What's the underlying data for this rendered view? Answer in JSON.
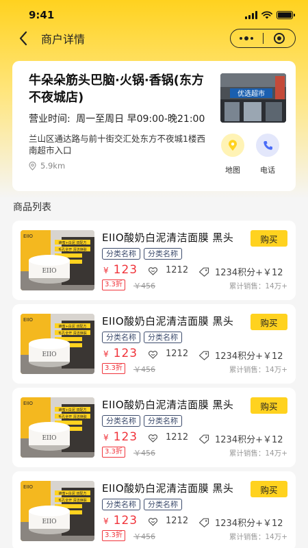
{
  "status_bar": {
    "time": "9:41"
  },
  "nav": {
    "title": "商户详情"
  },
  "shop": {
    "name": "牛朵朵筋头巴脑·火锅·香锅(东方不夜城店)",
    "hours_label": "营业时间:",
    "hours_value": "周一至周日 早09:00-晚21:00",
    "address": "兰山区通达路与前十街交汇处东方不夜城1楼西南超市入口",
    "distance": "5.9km",
    "photo_sign": "优选超市",
    "actions": [
      {
        "label": "地图",
        "icon": "map-pin-icon",
        "color": "#ffd21f"
      },
      {
        "label": "电话",
        "icon": "phone-icon",
        "color": "#4a6cf7"
      }
    ]
  },
  "section": {
    "title": "商品列表"
  },
  "products": [
    {
      "title": "EIIO酸奶白泥清洁面膜 黑头",
      "buy_label": "购买",
      "tags": [
        "分类名称",
        "分类名称"
      ],
      "currency": "¥",
      "price": "123",
      "likes": "1212",
      "points": "1234积分+￥12",
      "discount": "3.3折",
      "original_price": "￥456",
      "sales": "累计销售：14万+"
    },
    {
      "title": "EIIO酸奶白泥清洁面膜 黑头",
      "buy_label": "购买",
      "tags": [
        "分类名称",
        "分类名称"
      ],
      "currency": "¥",
      "price": "123",
      "likes": "1212",
      "points": "1234积分+￥12",
      "discount": "3.3折",
      "original_price": "￥456",
      "sales": "累计销售：14万+"
    },
    {
      "title": "EIIO酸奶白泥清洁面膜 黑头",
      "buy_label": "购买",
      "tags": [
        "分类名称",
        "分类名称"
      ],
      "currency": "¥",
      "price": "123",
      "likes": "1212",
      "points": "1234积分+￥12",
      "discount": "3.3折",
      "original_price": "￥456",
      "sales": "累计销售：14万+"
    },
    {
      "title": "EIIO酸奶白泥清洁面膜 黑头",
      "buy_label": "购买",
      "tags": [
        "分类名称",
        "分类名称"
      ],
      "currency": "¥",
      "price": "123",
      "likes": "1212",
      "points": "1234积分+￥12",
      "discount": "3.3折",
      "original_price": "￥456",
      "sales": "累计销售：14万+"
    }
  ],
  "product_image": {
    "brand": "EIIO",
    "jar_label": "EIIO",
    "banner_lines": [
      "蜂蜜+白泥 双配方",
      "毛孔全开 清洁焕肤"
    ]
  },
  "colors": {
    "accent": "#ffd21f",
    "price": "#f0333a",
    "tag": "#3b4a6b"
  }
}
